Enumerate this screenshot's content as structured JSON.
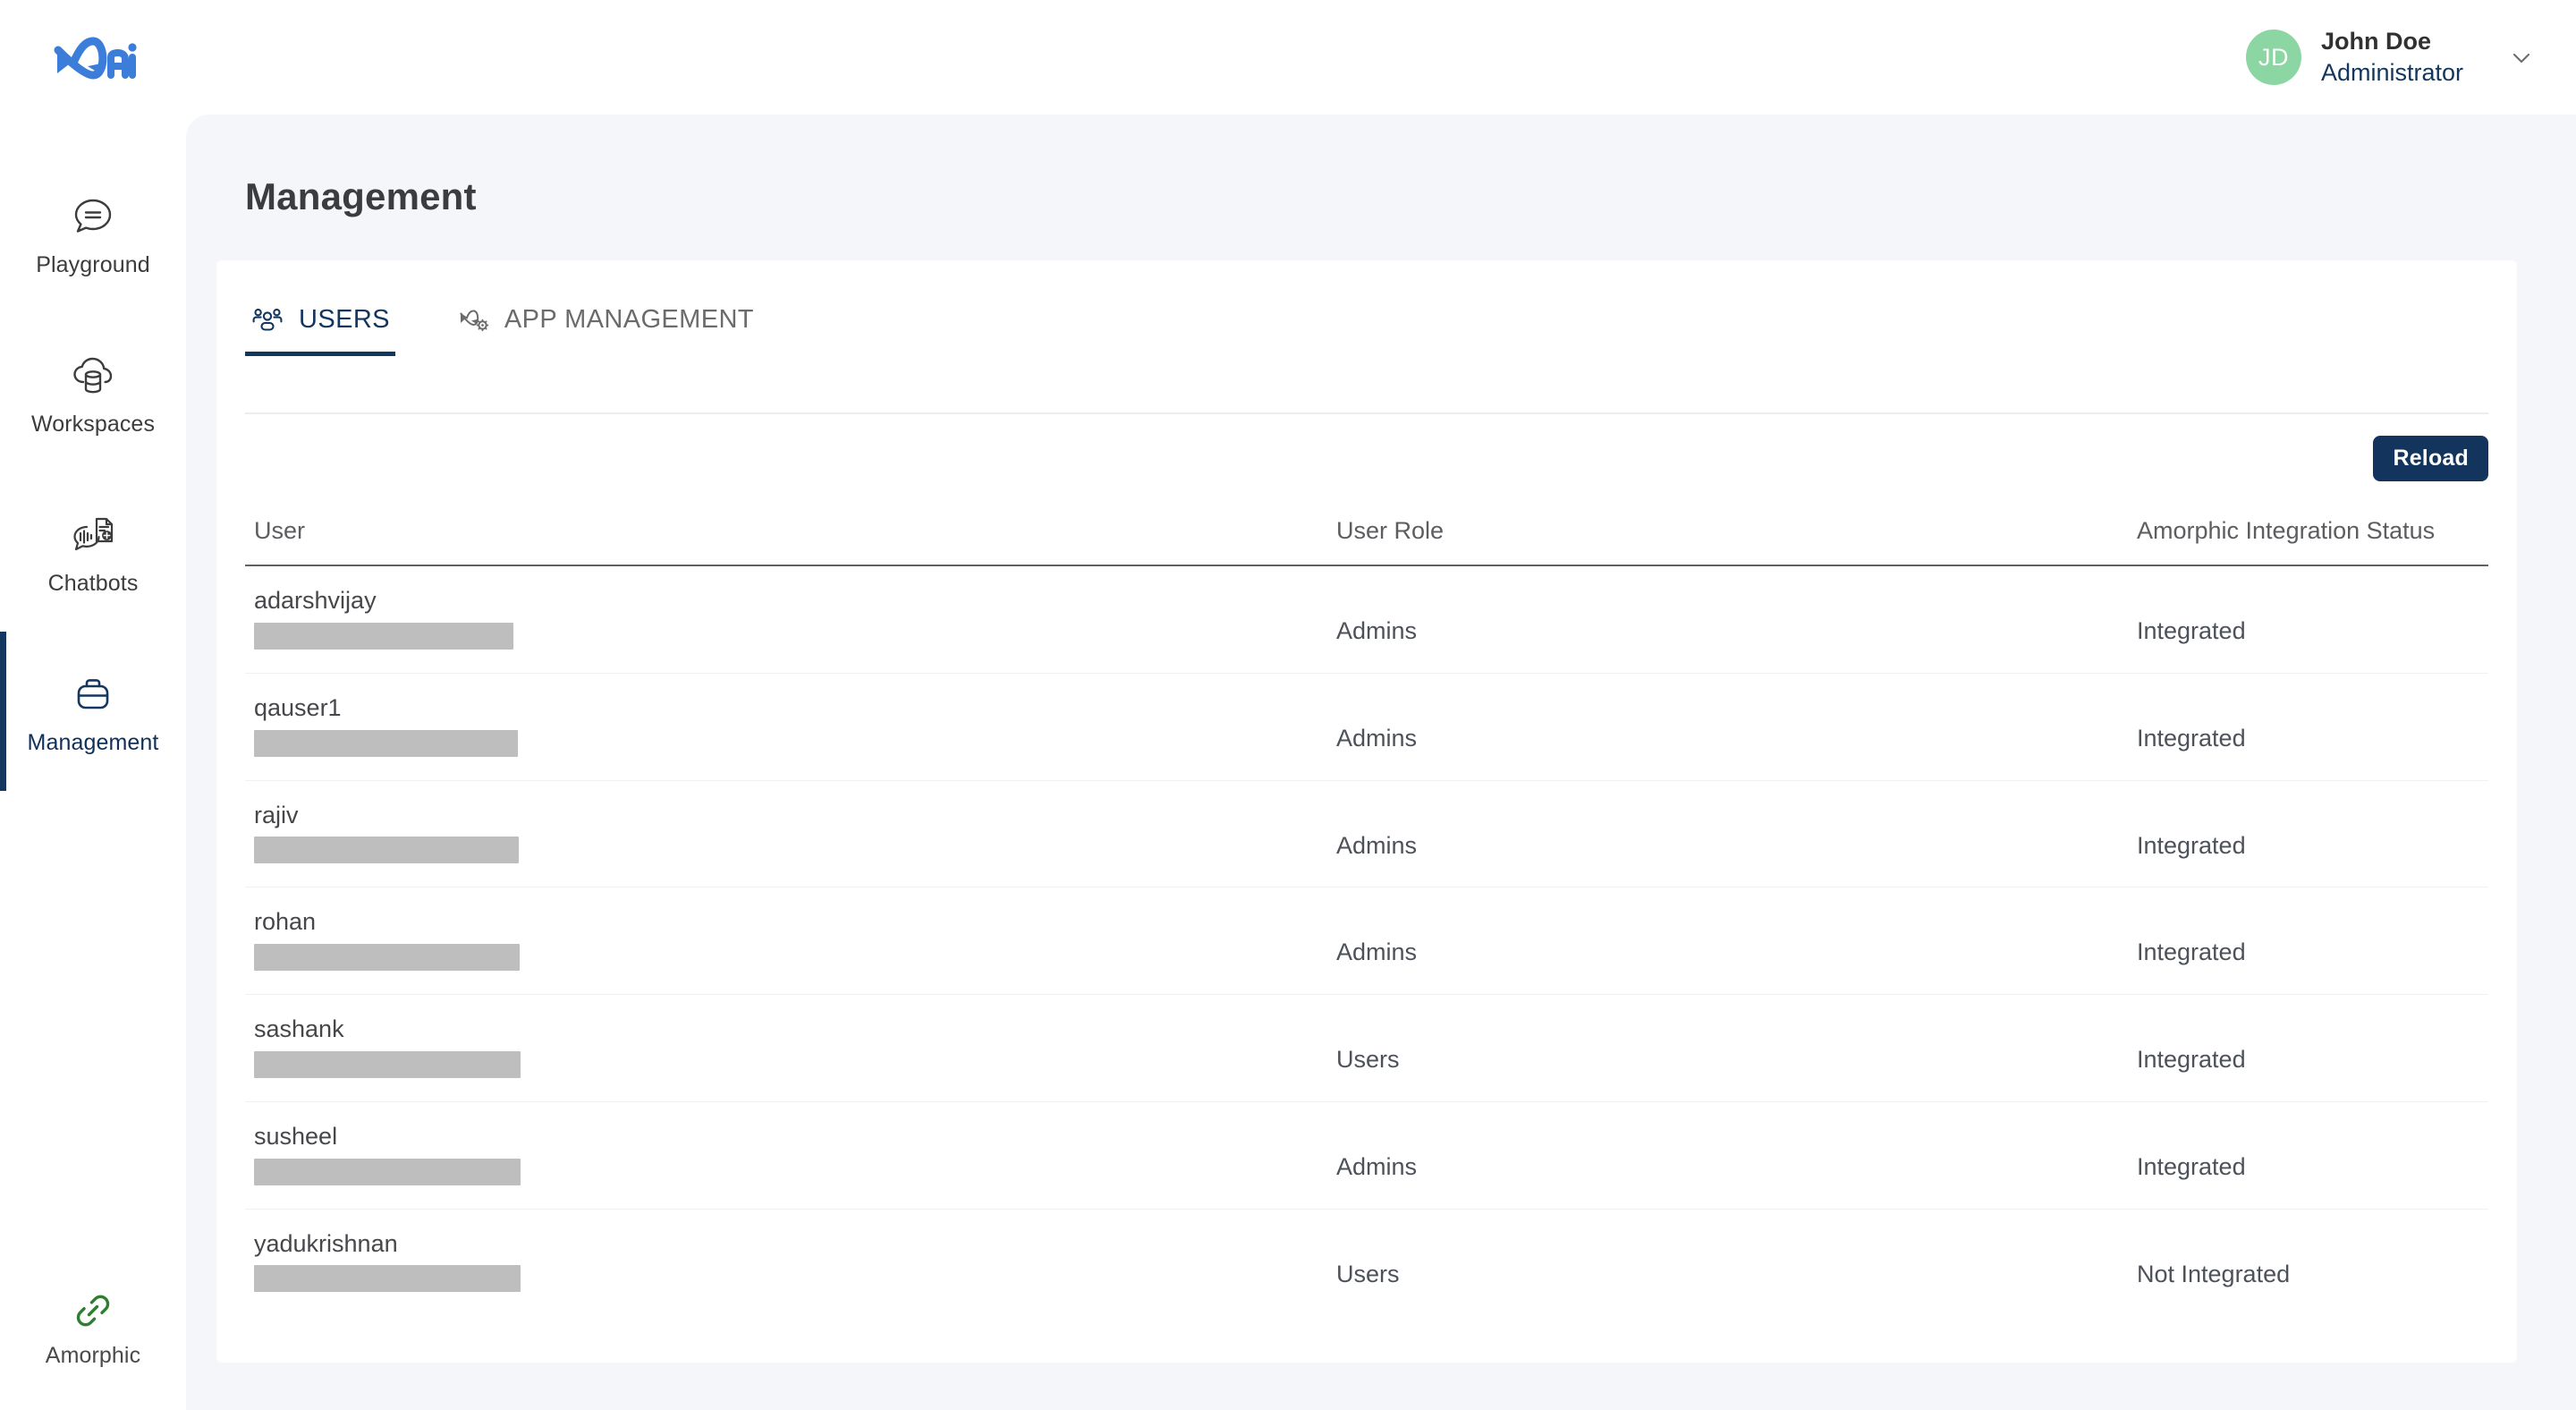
{
  "brand": {
    "logo_text": "ai",
    "logo_color": "#3b7dd8"
  },
  "sidebar": {
    "items": [
      {
        "label": "Playground",
        "icon": "chat-bubble-icon",
        "active": false
      },
      {
        "label": "Workspaces",
        "icon": "cloud-database-icon",
        "active": false
      },
      {
        "label": "Chatbots",
        "icon": "chat-document-icon",
        "active": false
      },
      {
        "label": "Management",
        "icon": "briefcase-icon",
        "active": true
      }
    ],
    "bottom_item": {
      "label": "Amorphic",
      "icon": "link-chain-icon",
      "color": "#2f7d32"
    }
  },
  "topbar": {
    "user": {
      "initials": "JD",
      "name": "John Doe",
      "role": "Administrator",
      "avatar_color": "#8bd6a2"
    },
    "chevron_icon": "chevron-down-icon"
  },
  "page": {
    "title": "Management"
  },
  "tabs": [
    {
      "label": "USERS",
      "icon": "users-group-icon",
      "active": true
    },
    {
      "label": "APP MANAGEMENT",
      "icon": "app-gear-icon",
      "active": false
    }
  ],
  "toolbar": {
    "reload_label": "Reload"
  },
  "table": {
    "columns": [
      "User",
      "User Role",
      "Amorphic Integration Status"
    ],
    "rows": [
      {
        "user": "adarshvijay",
        "email_redacted": true,
        "role": "Admins",
        "status": "Integrated"
      },
      {
        "user": "qauser1",
        "email_redacted": true,
        "role": "Admins",
        "status": "Integrated"
      },
      {
        "user": "rajiv",
        "email_redacted": true,
        "role": "Admins",
        "status": "Integrated"
      },
      {
        "user": "rohan",
        "email_redacted": true,
        "role": "Admins",
        "status": "Integrated"
      },
      {
        "user": "sashank",
        "email_redacted": true,
        "role": "Users",
        "status": "Integrated"
      },
      {
        "user": "susheel",
        "email_redacted": true,
        "role": "Admins",
        "status": "Integrated"
      },
      {
        "user": "yadukrishnan",
        "email_redacted": true,
        "role": "Users",
        "status": "Not Integrated"
      }
    ]
  },
  "colors": {
    "accent_navy": "#13355d",
    "brand_blue": "#3b7dd8",
    "page_bg": "#f4f6fa",
    "redaction": "#bebebe"
  }
}
